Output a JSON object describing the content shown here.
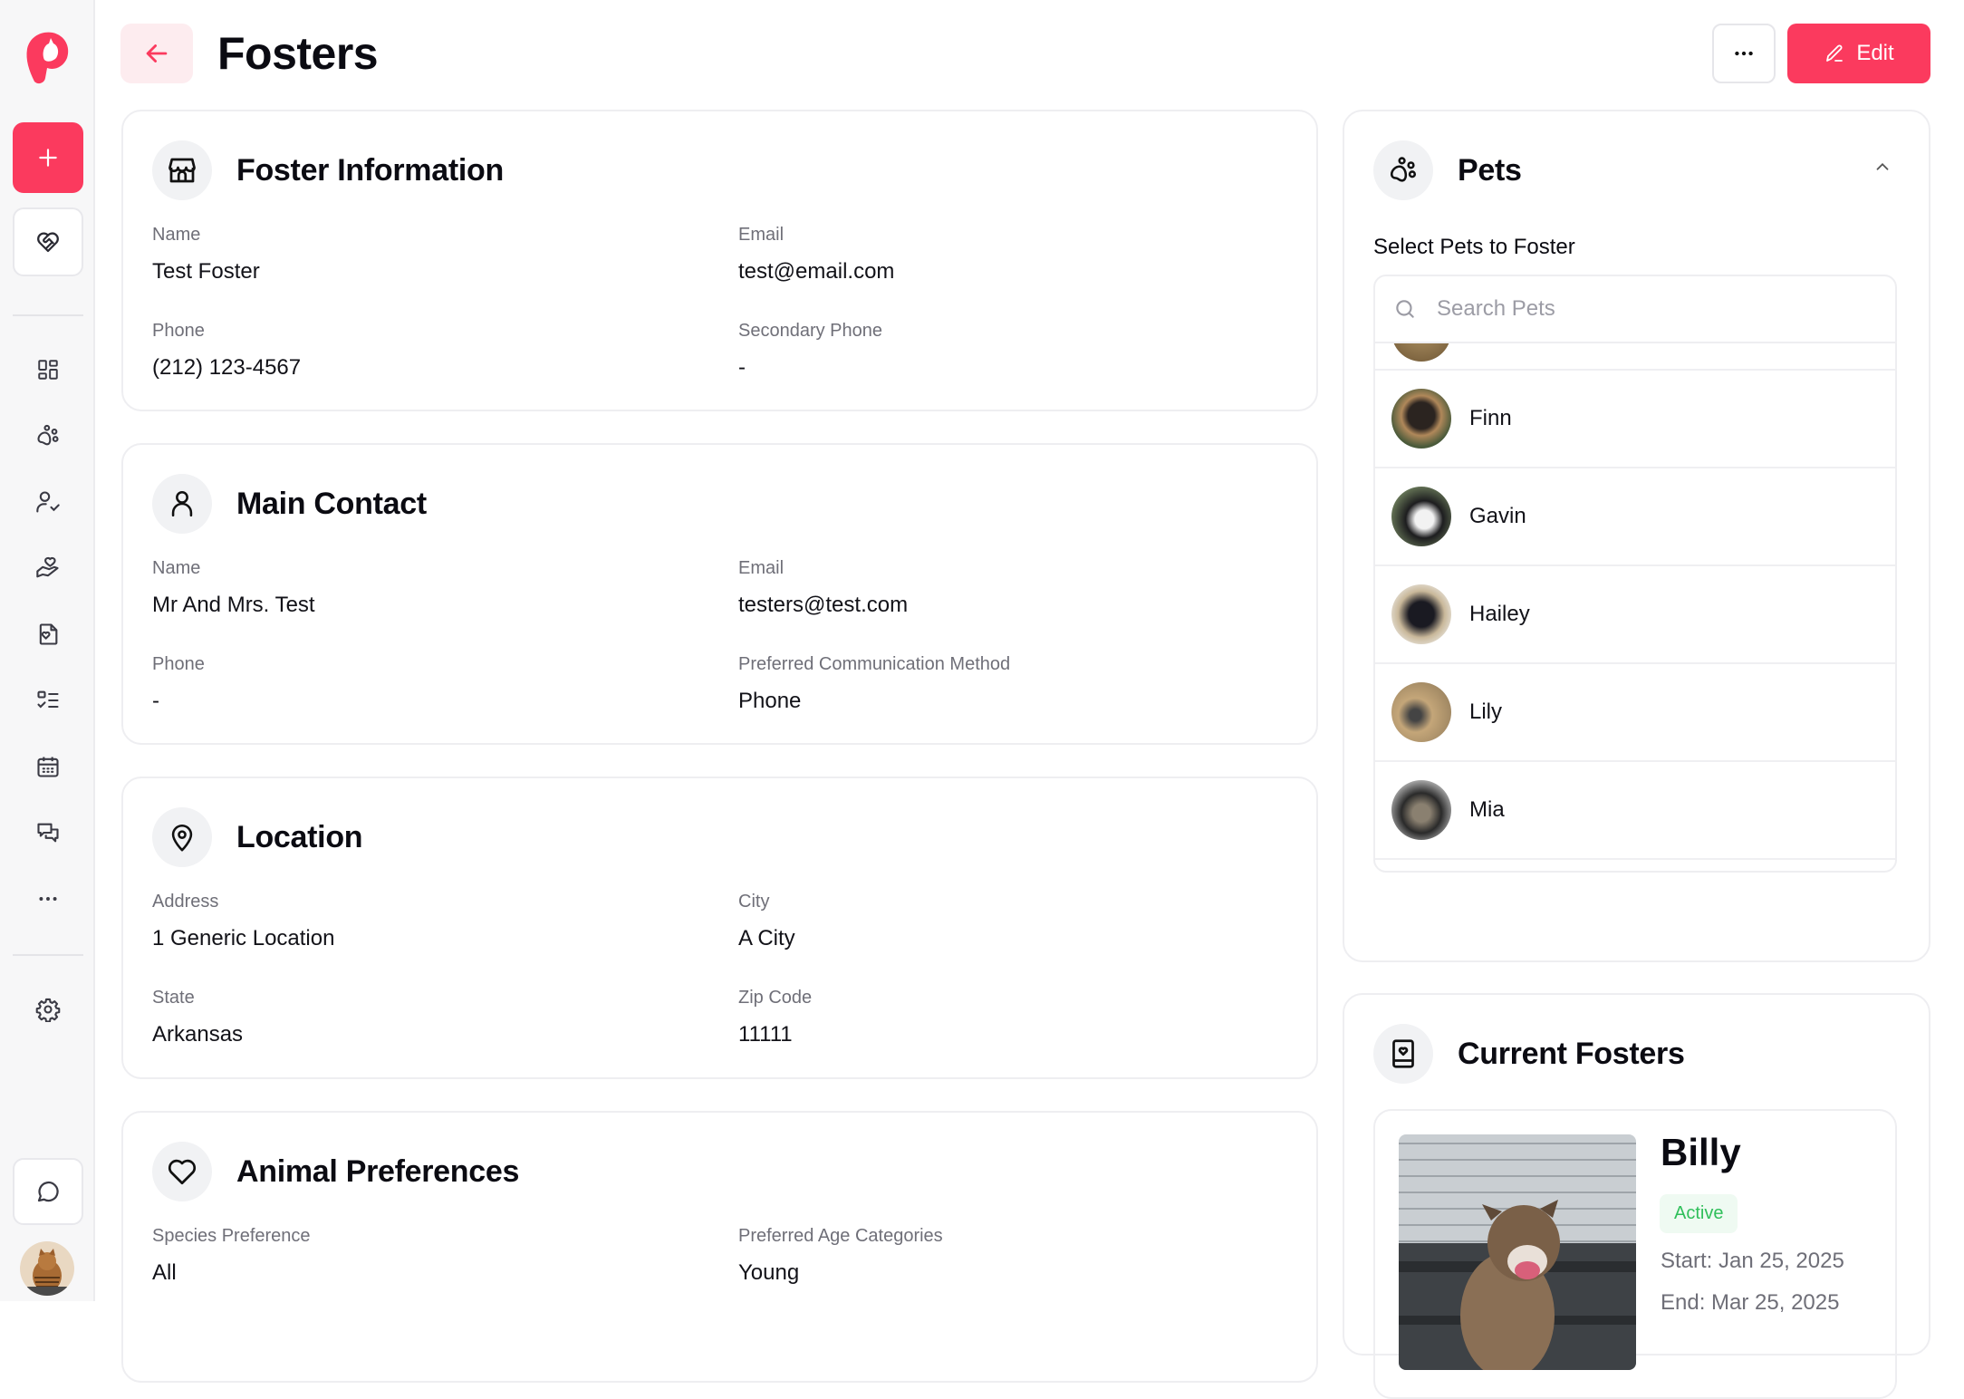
{
  "header": {
    "title": "Fosters",
    "back_icon": "arrow-left-icon",
    "more_icon": "ellipsis-icon",
    "edit_label": "Edit",
    "edit_icon": "pencil-icon"
  },
  "colors": {
    "accent": "#fb3a5e",
    "accent_soft": "#fdecef",
    "status_active": "#2fbf5a",
    "status_active_bg": "#effaf2"
  },
  "sidebar": {
    "logo": "app-logo",
    "add_icon": "plus-icon",
    "favorite_icon": "heart-handshake-icon",
    "nav": [
      {
        "icon": "dashboard-icon"
      },
      {
        "icon": "paw-icon"
      },
      {
        "icon": "user-check-icon"
      },
      {
        "icon": "hand-heart-icon"
      },
      {
        "icon": "document-heart-icon"
      },
      {
        "icon": "checklist-icon"
      },
      {
        "icon": "calendar-icon"
      },
      {
        "icon": "messages-icon"
      },
      {
        "icon": "more-icon"
      }
    ],
    "settings_icon": "gear-icon",
    "chat_icon": "chat-bubble-icon",
    "avatar": "user-avatar"
  },
  "sections": {
    "foster_info": {
      "title": "Foster Information",
      "icon": "storefront-icon",
      "fields": [
        {
          "label": "Name",
          "value": "Test Foster"
        },
        {
          "label": "Email",
          "value": "test@email.com"
        },
        {
          "label": "Phone",
          "value": "(212) 123-4567"
        },
        {
          "label": "Secondary Phone",
          "value": "-"
        }
      ]
    },
    "main_contact": {
      "title": "Main Contact",
      "icon": "user-icon",
      "fields": [
        {
          "label": "Name",
          "value": "Mr And Mrs. Test"
        },
        {
          "label": "Email",
          "value": "testers@test.com"
        },
        {
          "label": "Phone",
          "value": "-"
        },
        {
          "label": "Preferred Communication Method",
          "value": "Phone"
        }
      ]
    },
    "location": {
      "title": "Location",
      "icon": "map-pin-icon",
      "fields": [
        {
          "label": "Address",
          "value": "1 Generic Location"
        },
        {
          "label": "City",
          "value": "A City"
        },
        {
          "label": "State",
          "value": "Arkansas"
        },
        {
          "label": "Zip Code",
          "value": "11111"
        }
      ]
    },
    "animal_prefs": {
      "title": "Animal Preferences",
      "icon": "heart-icon",
      "fields": [
        {
          "label": "Species Preference",
          "value": "All"
        },
        {
          "label": "Preferred Age Categories",
          "value": "Young"
        }
      ]
    }
  },
  "pets": {
    "title": "Pets",
    "icon": "paw-icon",
    "collapse_icon": "chevron-up-icon",
    "select_label": "Select Pets to Foster",
    "search_placeholder": "Search Pets",
    "search_value": "",
    "items": [
      {
        "name": "Finn"
      },
      {
        "name": "Gavin"
      },
      {
        "name": "Hailey"
      },
      {
        "name": "Lily"
      },
      {
        "name": "Mia"
      }
    ]
  },
  "current_fosters": {
    "title": "Current Fosters",
    "icon": "contact-book-heart-icon",
    "items": [
      {
        "name": "Billy",
        "status": "Active",
        "start": "Start: Jan 25, 2025",
        "end": "End: Mar 25, 2025"
      }
    ]
  }
}
